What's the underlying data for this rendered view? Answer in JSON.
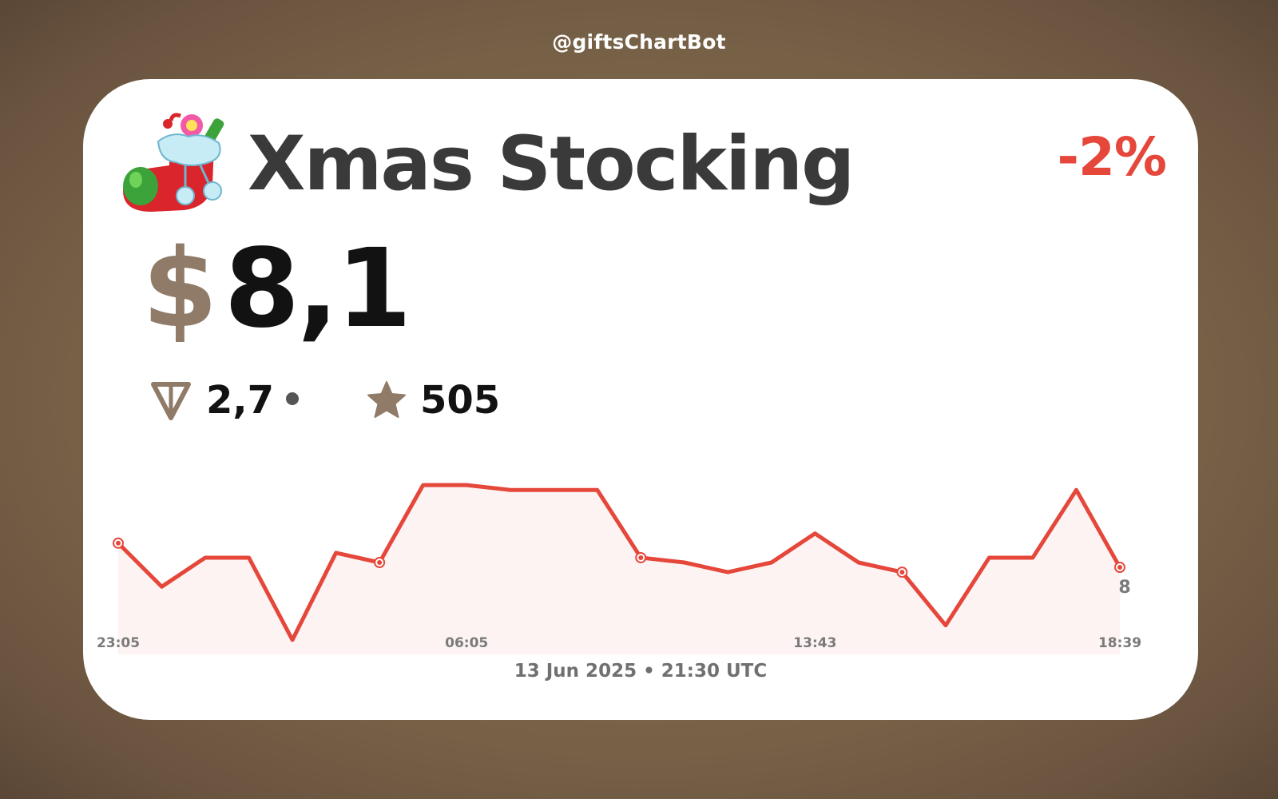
{
  "header": {
    "bot_handle": "@giftsChartBot"
  },
  "gift": {
    "name": "Xmas Stocking",
    "change": "-2%",
    "currency_symbol": "$",
    "price": "8,1",
    "ton_price": "2,7",
    "stars_price": "505",
    "icon": "xmas-stocking-icon"
  },
  "colors": {
    "line": "#e5473b",
    "area": "#fdf3f2",
    "accent_brown": "#8f7b67",
    "title": "#3a3a3a",
    "background": "#7a6448"
  },
  "footer": {
    "date": "13 Jun 2025 • 21:30 UTC"
  },
  "chart_data": {
    "type": "area",
    "values": [
      8.6,
      7.7,
      8.3,
      8.3,
      6.6,
      8.4,
      8.2,
      9.8,
      9.8,
      9.7,
      9.7,
      9.7,
      8.3,
      8.2,
      8.0,
      8.2,
      8.8,
      8.2,
      8.0,
      6.9,
      8.3,
      8.3,
      9.7,
      8.1
    ],
    "ylim": [
      6.3,
      10.1
    ],
    "x_ticks": [
      {
        "index": 0,
        "label": "23:05"
      },
      {
        "index": 8,
        "label": "06:05"
      },
      {
        "index": 16,
        "label": "13:43"
      },
      {
        "index": 23,
        "label": "18:39"
      }
    ],
    "markers": [
      0,
      6,
      12,
      18,
      23
    ],
    "last_value_label": "8",
    "grid": false,
    "legend": "none"
  }
}
